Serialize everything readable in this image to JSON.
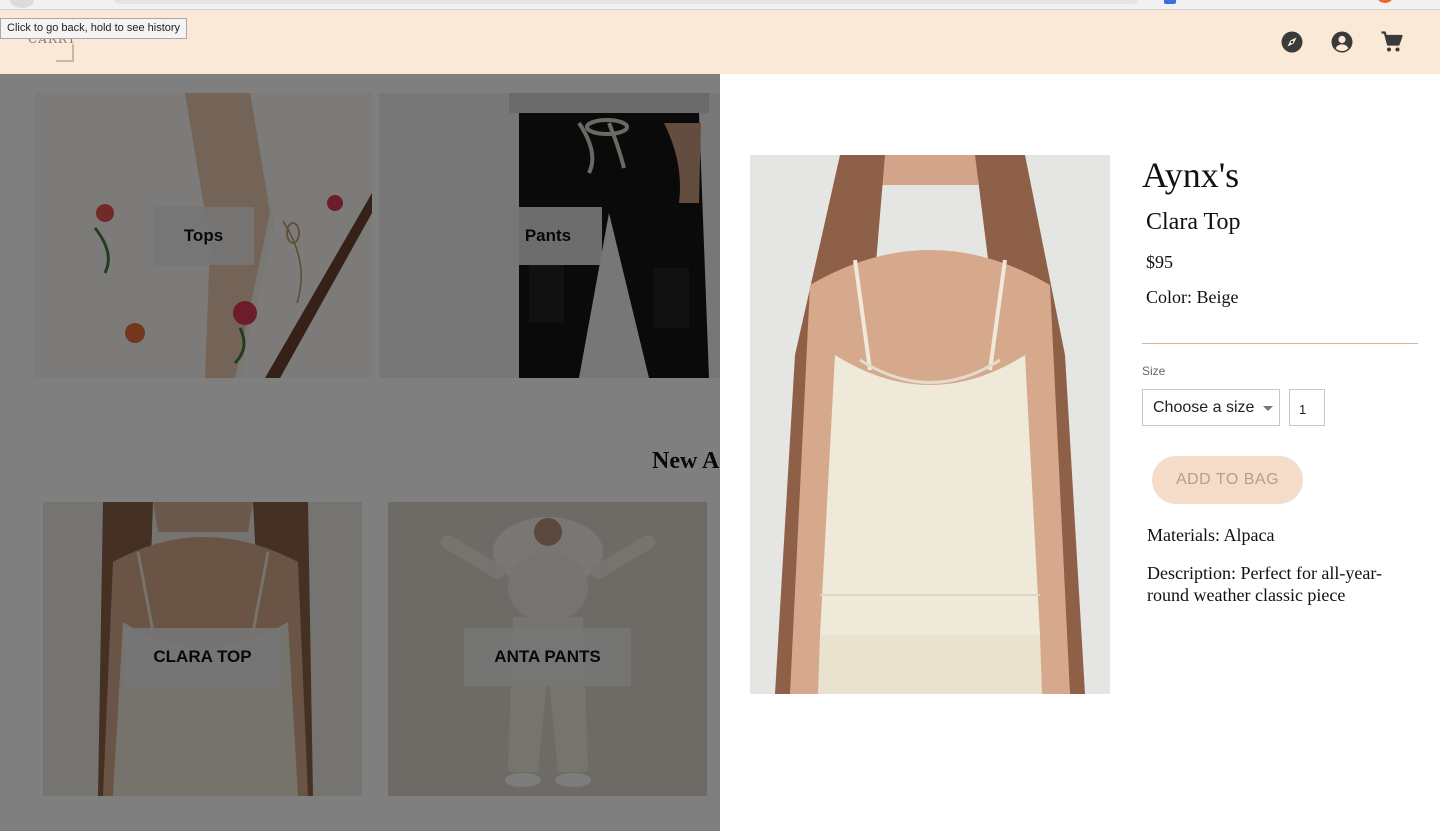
{
  "browser": {
    "back_tooltip": "Click to go back, hold to see history"
  },
  "header": {
    "logo_text": "CARRY",
    "icons": [
      "compass-icon",
      "account-icon",
      "cart-icon"
    ],
    "background_color": "#fbe9d7"
  },
  "background_page": {
    "categories": [
      {
        "label": "Tops"
      },
      {
        "label": "Pants"
      }
    ],
    "section_heading": "New A",
    "products": [
      {
        "label": "CLARA TOP"
      },
      {
        "label": "ANTA PANTS"
      }
    ]
  },
  "product": {
    "brand": "Aynx's",
    "name": "Clara Top",
    "price": "$95",
    "color": "Color: Beige",
    "size_label": "Size",
    "size_select_value": "Choose a size",
    "quantity": "1",
    "add_to_bag_label": "ADD TO BAG",
    "materials": "Materials: Alpaca",
    "description": "Description: Perfect for all-year-round weather classic piece"
  },
  "colors": {
    "accent": "#f4dcc8",
    "divider": "#d9b79a",
    "overlay": "rgba(0,0,0,0.5)"
  }
}
